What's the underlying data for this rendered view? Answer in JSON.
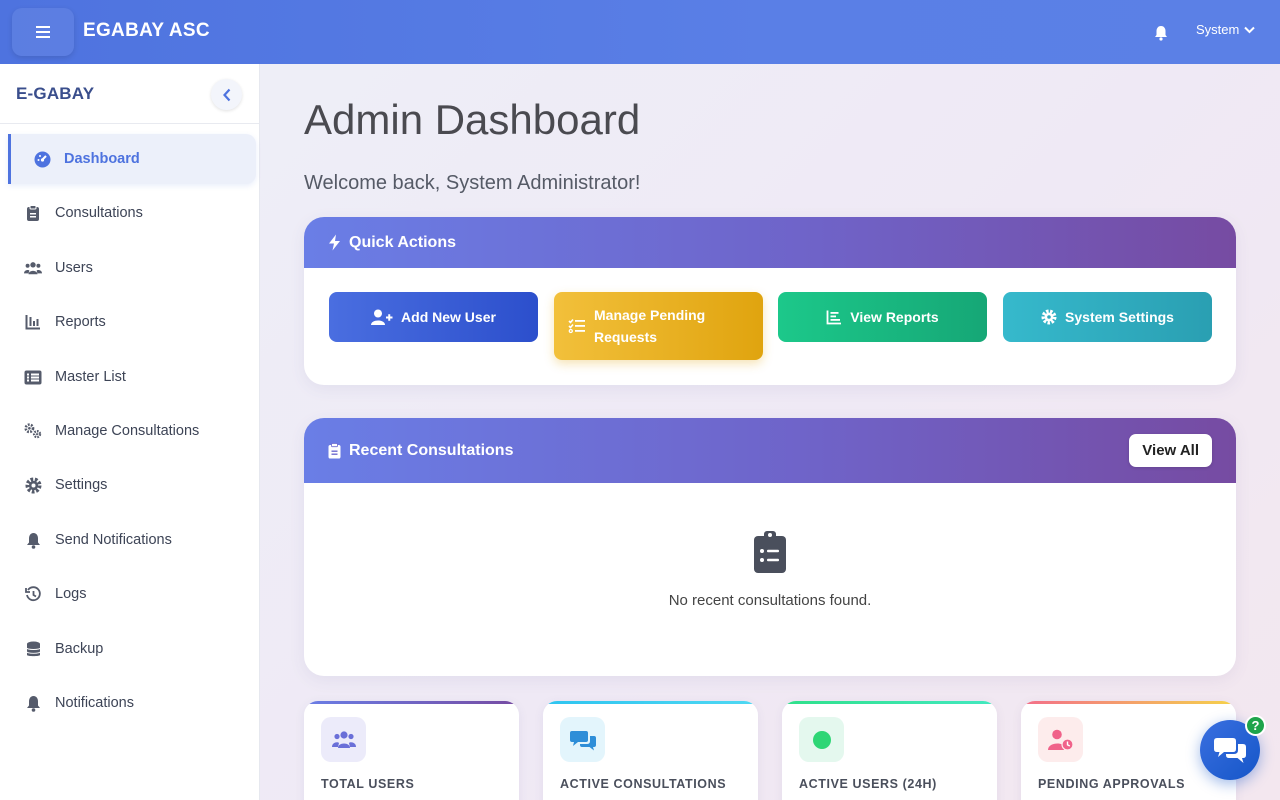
{
  "topbar": {
    "brand": "EGABAY ASC",
    "user_label": "System"
  },
  "sidebar": {
    "title": "E-GABAY",
    "items": [
      {
        "label": "Dashboard",
        "icon": "dashboard-gauge-icon",
        "active": true
      },
      {
        "label": "Consultations",
        "icon": "clipboard-icon"
      },
      {
        "label": "Users",
        "icon": "users-icon"
      },
      {
        "label": "Reports",
        "icon": "chart-bar-icon"
      },
      {
        "label": "Master List",
        "icon": "list-icon"
      },
      {
        "label": "Manage Consultations",
        "icon": "cogs-icon"
      },
      {
        "label": "Settings",
        "icon": "gear-icon"
      },
      {
        "label": "Send Notifications",
        "icon": "bell-icon"
      },
      {
        "label": "Logs",
        "icon": "history-icon"
      },
      {
        "label": "Backup",
        "icon": "database-icon"
      },
      {
        "label": "Notifications",
        "icon": "bell-icon"
      }
    ]
  },
  "main": {
    "title": "Admin Dashboard",
    "welcome": "Welcome back, System Administrator!"
  },
  "quick_actions": {
    "title": "Quick Actions",
    "buttons": [
      {
        "label": "Add New User",
        "color": "#2c4fcc"
      },
      {
        "label": "Manage Pending Requests",
        "color": "#e0a40f"
      },
      {
        "label": "View Reports",
        "color": "#16a776"
      },
      {
        "label": "System Settings",
        "color": "#2a9fb2"
      }
    ]
  },
  "recent_consultations": {
    "title": "Recent Consultations",
    "view_all": "View All",
    "empty_text": "No recent consultations found."
  },
  "stats": [
    {
      "label": "TOTAL USERS",
      "color": "#6f63c8"
    },
    {
      "label": "ACTIVE CONSULTATIONS",
      "color": "#2ec4f0"
    },
    {
      "label": "ACTIVE USERS (24H)",
      "color": "#2fe08a"
    },
    {
      "label": "PENDING APPROVALS",
      "color": "#f36e8a"
    }
  ],
  "chat": {
    "badge": "?"
  }
}
